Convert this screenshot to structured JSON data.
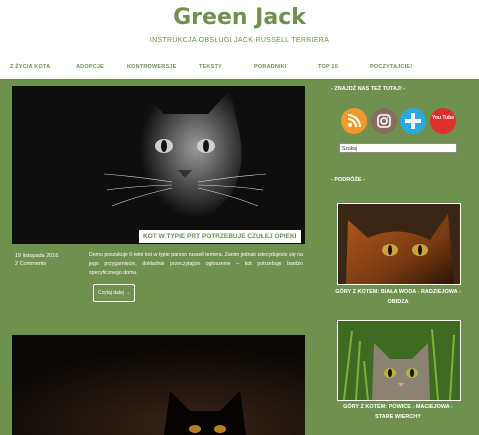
{
  "site": {
    "title": "Green Jack",
    "tagline": "INSTRUKCJA OBSŁUGI JACK RUSSELL TERRIERA"
  },
  "nav": {
    "items": [
      "Z ŻYCIA KOTA",
      "ADOPCJE",
      "KONTROWERSJE",
      "TEKSTY",
      "PORADNIKI",
      "TOP 10",
      "POCZYTAJCIE!"
    ]
  },
  "posts": [
    {
      "caption": "KOT W TYPIE PRT POTRZEBUJE CZUŁEJ OPIEKI",
      "date": "19 listopada 2016",
      "comments": "2 Comments",
      "excerpt": "Domu poszukuje 6-letni kot w typie parson russell terriera. Zanim jednak zdecydujecie się na jego przygarnięcie, dokładnie przeczytajcie ogłoszenie – kot potrzebuje bardzo specyficznego domu.",
      "read_more": "Czytaj dalej →"
    },
    {
      "caption": ""
    }
  ],
  "sidebar": {
    "find_us_heading": "- ZNAJDŹ NAS TEŻ TUTAJ! -",
    "social": [
      "rss-icon",
      "instagram-icon",
      "plus-icon",
      "youtube-icon"
    ],
    "youtube_text": "You Tube",
    "search_value": "Szukaj",
    "travels_heading": "- PODRÓŻE -",
    "travels": [
      {
        "caption": "GÓRY Z KOTEM: BIAŁA WODA - RADZIEJOWA - OBIDZA"
      },
      {
        "caption": "GÓRY Z KOTEM: POWICE - MACIEJOWA - STARE WIERCHY"
      }
    ]
  },
  "colors": {
    "accent": "#6f9150",
    "header_bg": "#ffffff",
    "rss": "#f2992e",
    "instagram": "#8a6b63",
    "plus": "#2aa9e0",
    "youtube": "#e0302b"
  }
}
